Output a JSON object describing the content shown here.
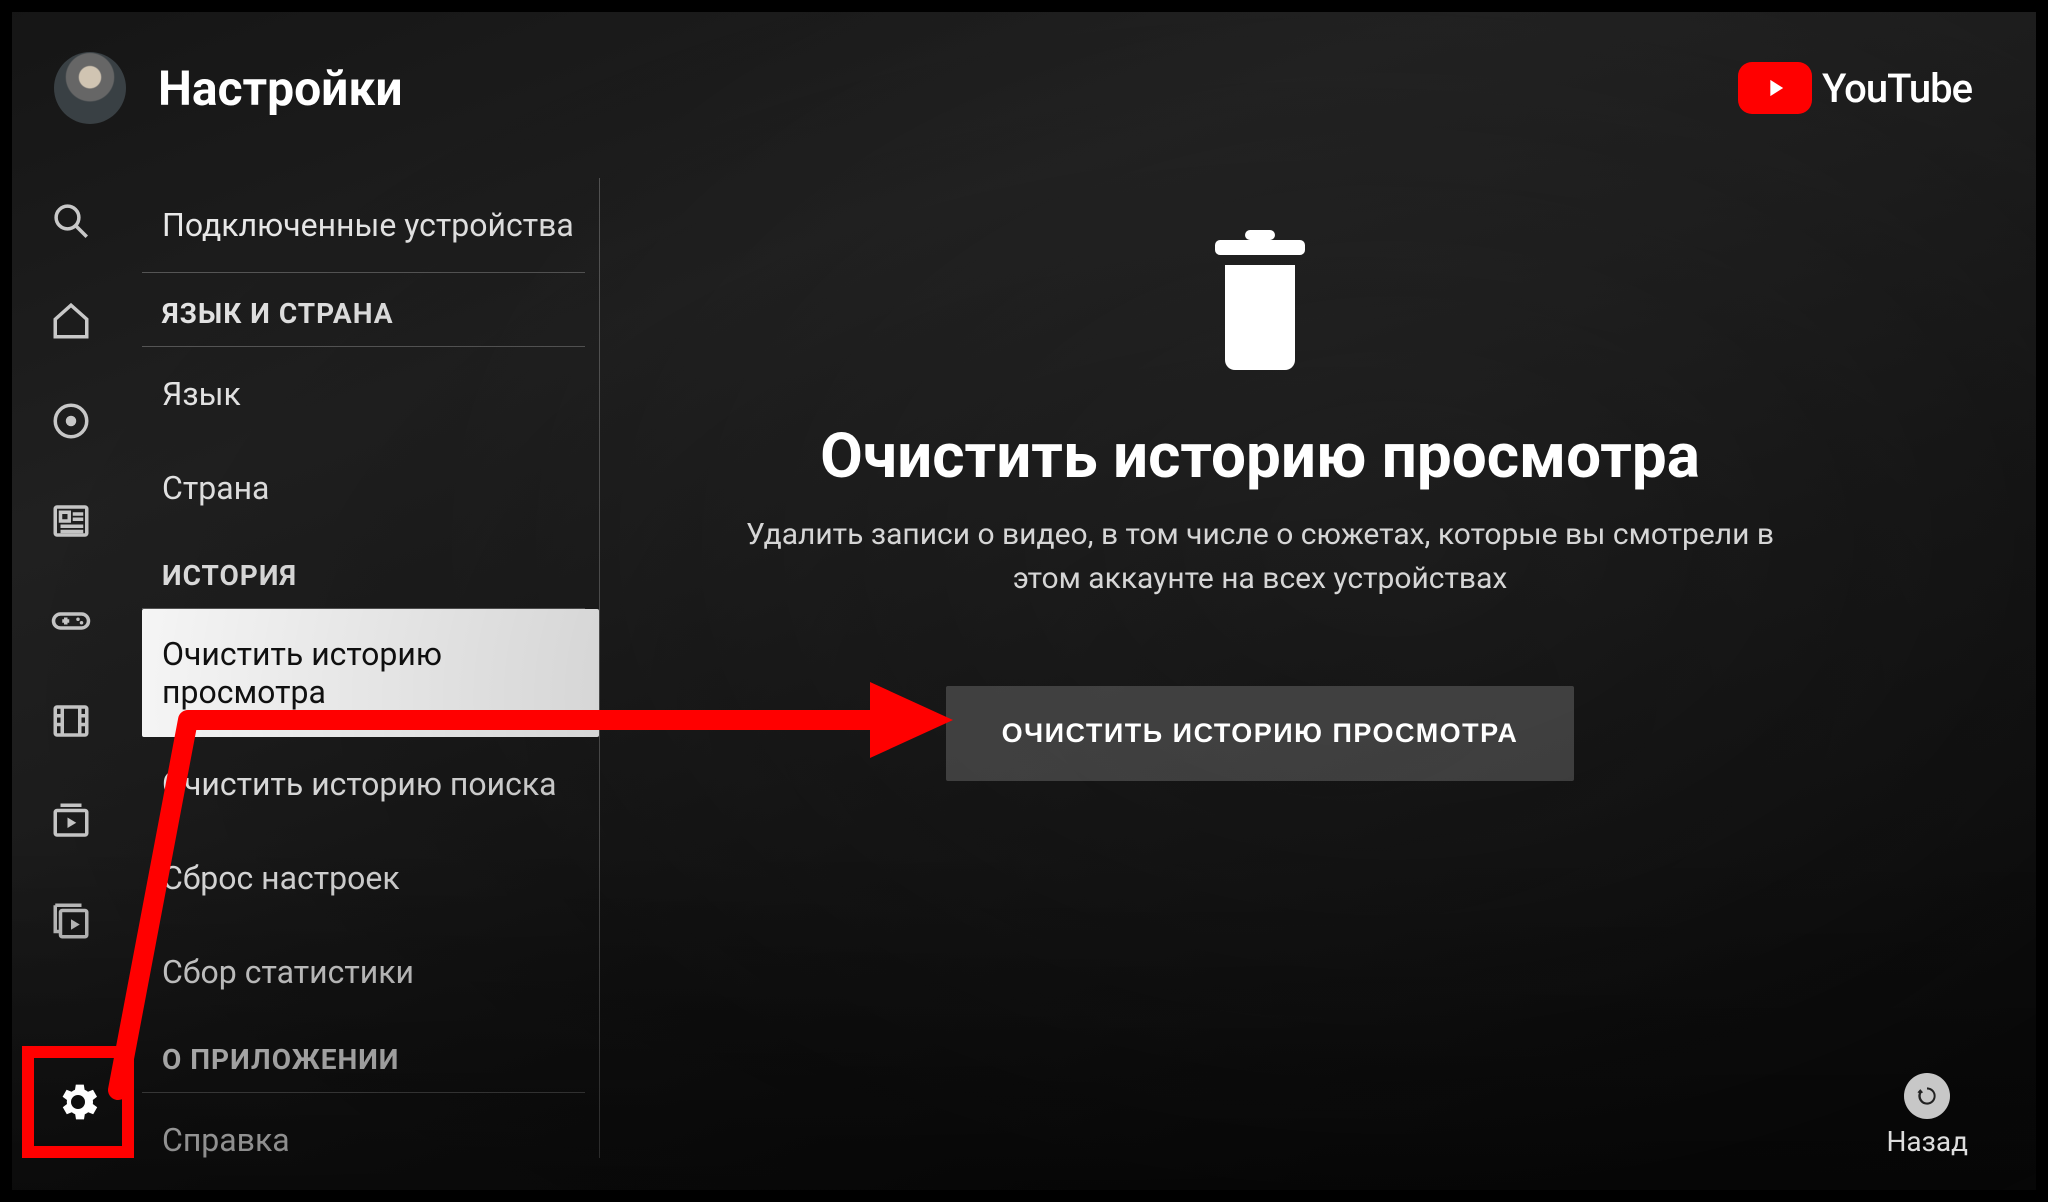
{
  "header": {
    "title": "Настройки"
  },
  "brand": {
    "name": "YouTube"
  },
  "sidebar": {
    "connected": "Подключенные устройства",
    "sec_lang": "ЯЗЫК И СТРАНА",
    "language": "Язык",
    "country": "Страна",
    "sec_history": "ИСТОРИЯ",
    "clear_watch": "Очистить историю просмотра",
    "clear_search": "Очистить историю поиска",
    "reset": "Сброс настроек",
    "stats": "Сбор статистики",
    "sec_about": "О ПРИЛОЖЕНИИ",
    "help": "Справка"
  },
  "detail": {
    "title": "Очистить историю просмотра",
    "desc": "Удалить записи о видео, в том числе о сюжетах, которые вы смотрели в этом аккаунте на всех устройствах",
    "button": "ОЧИСТИТЬ ИСТОРИЮ ПРОСМОТРА"
  },
  "footer": {
    "back": "Назад"
  }
}
